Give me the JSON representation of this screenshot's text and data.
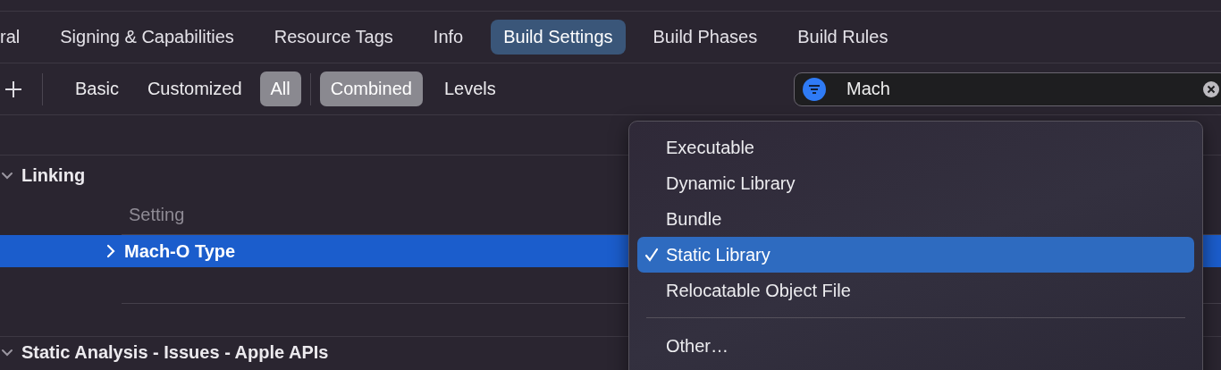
{
  "tabs": [
    {
      "label": "ral",
      "selected": false
    },
    {
      "label": "Signing & Capabilities",
      "selected": false
    },
    {
      "label": "Resource Tags",
      "selected": false
    },
    {
      "label": "Info",
      "selected": false
    },
    {
      "label": "Build Settings",
      "selected": true
    },
    {
      "label": "Build Phases",
      "selected": false
    },
    {
      "label": "Build Rules",
      "selected": false
    }
  ],
  "filter_bar": {
    "scopes": [
      {
        "label": "Basic",
        "selected": false
      },
      {
        "label": "Customized",
        "selected": false
      },
      {
        "label": "All",
        "selected": true
      }
    ],
    "views": [
      {
        "label": "Combined",
        "selected": true
      },
      {
        "label": "Levels",
        "selected": false
      }
    ]
  },
  "search": {
    "value": "Mach"
  },
  "sections": [
    {
      "title": "Linking",
      "expanded": true,
      "column_header": "Setting",
      "rows": [
        {
          "name": "Mach-O Type",
          "expanded": false,
          "selected": true
        }
      ]
    },
    {
      "title": "Static Analysis - Issues - Apple APIs",
      "expanded": true
    }
  ],
  "menu": {
    "items": [
      {
        "kind": "option",
        "label": "Executable",
        "checked": false
      },
      {
        "kind": "option",
        "label": "Dynamic Library",
        "checked": false
      },
      {
        "kind": "option",
        "label": "Bundle",
        "checked": false
      },
      {
        "kind": "option",
        "label": "Static Library",
        "checked": true
      },
      {
        "kind": "option",
        "label": "Relocatable Object File",
        "checked": false
      },
      {
        "kind": "separator"
      },
      {
        "kind": "option",
        "label": "Other…",
        "checked": false
      }
    ]
  }
}
